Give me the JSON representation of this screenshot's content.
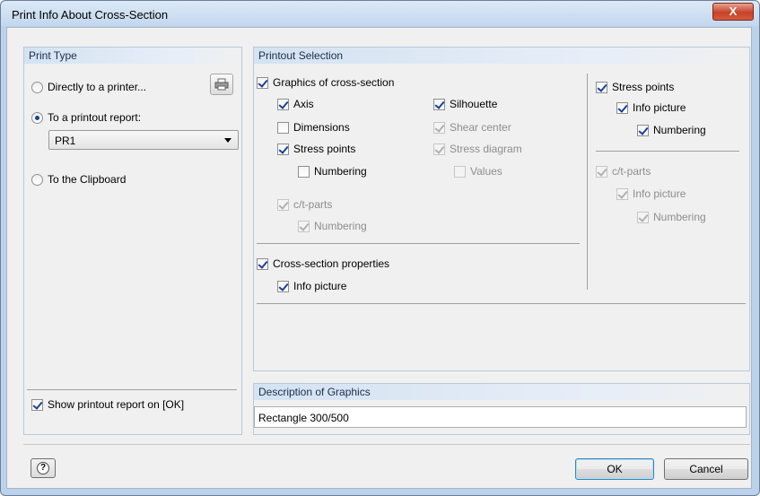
{
  "window": {
    "title": "Print Info About Cross-Section",
    "close_label": "X"
  },
  "print_type": {
    "header": "Print Type",
    "options": [
      {
        "label": "Directly to a printer...",
        "selected": false
      },
      {
        "label": "To a printout report:",
        "selected": true
      },
      {
        "label": "To the Clipboard",
        "selected": false
      }
    ],
    "report_select": {
      "value": "PR1"
    },
    "show_report": {
      "label": "Show printout report on [OK]",
      "checked": true
    }
  },
  "printout_selection": {
    "header": "Printout Selection",
    "graphics": {
      "label": "Graphics of cross-section",
      "checked": true
    },
    "axis": {
      "label": "Axis",
      "checked": true
    },
    "dimensions": {
      "label": "Dimensions",
      "checked": false
    },
    "stress_points": {
      "label": "Stress points",
      "checked": true
    },
    "stress_points_numbering": {
      "label": "Numbering",
      "checked": false
    },
    "ct_parts": {
      "label": "c/t-parts",
      "checked": true,
      "disabled": true
    },
    "ct_parts_numbering": {
      "label": "Numbering",
      "checked": true,
      "disabled": true
    },
    "silhouette": {
      "label": "Silhouette",
      "checked": true
    },
    "shear_center": {
      "label": "Shear center",
      "checked": true,
      "disabled": true
    },
    "stress_diagram": {
      "label": "Stress diagram",
      "checked": true,
      "disabled": true
    },
    "values": {
      "label": "Values",
      "checked": false,
      "disabled": true
    },
    "cs_properties": {
      "label": "Cross-section properties",
      "checked": true
    },
    "cs_info_picture": {
      "label": "Info picture",
      "checked": true
    },
    "right_stress_points": {
      "label": "Stress points",
      "checked": true
    },
    "right_info_picture": {
      "label": "Info picture",
      "checked": true
    },
    "right_numbering": {
      "label": "Numbering",
      "checked": true
    },
    "right_ct_parts": {
      "label": "c/t-parts",
      "checked": true,
      "disabled": true
    },
    "right_ct_info_picture": {
      "label": "Info picture",
      "checked": true,
      "disabled": true
    },
    "right_ct_numbering": {
      "label": "Numbering",
      "checked": true,
      "disabled": true
    }
  },
  "description": {
    "header": "Description of Graphics",
    "value": "Rectangle 300/500"
  },
  "footer": {
    "ok_label": "OK",
    "cancel_label": "Cancel",
    "help_label": "?"
  }
}
